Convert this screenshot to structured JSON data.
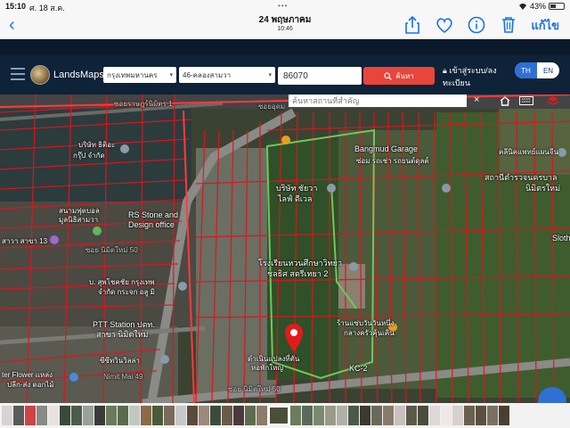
{
  "status": {
    "time": "15:10",
    "date": "ศ. 18 ส.ค.",
    "grabber": "•••",
    "battery": "43%"
  },
  "viewer": {
    "title": "24 พฤษภาคม",
    "subtitle": "10:46",
    "edit_label": "แก้ไข"
  },
  "app": {
    "brand": "LandsMaps",
    "province": "กรุงเทพมหานคร",
    "district": "46-คลองสามวา",
    "parcel_value": "86070",
    "search_label": "ค้นหา",
    "login_label": "เข้าสู่ระบบ/ลงทะเบียน",
    "lang_th": "TH",
    "lang_en": "EN",
    "place_search_placeholder": "ค้นหาสถานที่สำคัญ",
    "close_label": "×"
  },
  "map_labels": {
    "l1": "ซอยราษฎร์นิมิตร 1",
    "l2": "บริษัท ธิติอะ",
    "l3": "กรุ๊ป จำกัด",
    "l4": "สนามฟุตบอล",
    "l5": "มูลนิธิสามวา",
    "l6": "RS Stone and",
    "l7": "Design office",
    "l8": "สาวา สาขา 13",
    "l9": "ซอย นิมิตใหม่ 50",
    "l10": "บ. สุพโชคชัย กรุงเทพ",
    "l11": "จำกัด กระจก อลู มิ",
    "l12": "PTT Station ปตท.",
    "l13": "สาขา นิมิตใหม่",
    "l14": "ซีซีทวินวิลล่า",
    "l15": "ter Flower แหล่ง",
    "l16": "ปลีก-ส่ง ดอกไม้",
    "l17": "Nimit Mai 49",
    "l18": "Bangmud Garage",
    "l19": "ซ่อม รถเช่า รถยนต์ดุลต์",
    "l20": "บริษัท ชัยวา",
    "l21": "ไลฟ์ ดีเวล",
    "l22": "โรงเรียนหวนศึกษาวิทยา",
    "l23": "ชลธิศ สตรีเทยา 2",
    "l24": "ร้านแซ่บวันวันหนึ่ง",
    "l25": "กลางครัวคุ้นเคิน",
    "l26": "ดำเนินแปลงที่ตัน",
    "l27": "หอพักใหญ่",
    "l28": "KC-2",
    "l29": "ซอย นิมิตใหม่ 50",
    "l30": "สถานีตำรวจนครบาล",
    "l31": "นิมิตรใหม่",
    "l32": "คลีนิคแพทย์แผนจีน",
    "l33": "Sloth",
    "l34": "ซอยอุดม"
  },
  "colors": {
    "accent": "#1a73e8",
    "search_button": "#e8453c",
    "header": "#0e2238",
    "parcel_line": "#e0141e",
    "selection_line": "#6ec85a",
    "marker": "#e41a1a"
  }
}
